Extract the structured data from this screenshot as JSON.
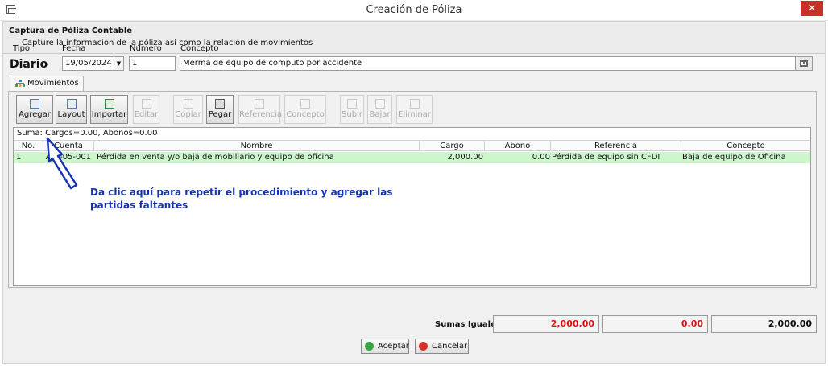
{
  "window": {
    "title": "Creación de Póliza",
    "close_glyph": "✕"
  },
  "header": {
    "title": "Captura de Póliza Contable",
    "subtitle": "Capture la información de la póliza así como la relación de movimientos"
  },
  "form": {
    "tipo_label": "Tipo",
    "tipo_value": "Diario",
    "fecha_label": "Fecha",
    "fecha_value": "19/05/2024",
    "numero_label": "Número",
    "numero_value": "1",
    "concepto_label": "Concepto",
    "concepto_value": "Merma de equipo de computo por accidente"
  },
  "tab": {
    "label": "Movimientos"
  },
  "toolbar": [
    {
      "label": "Agregar",
      "enabled": true,
      "icon": "add-icon"
    },
    {
      "label": "Layout",
      "enabled": true,
      "icon": "layout-icon"
    },
    {
      "label": "Importar",
      "enabled": true,
      "icon": "excel-import-icon"
    },
    {
      "label": "Editar",
      "enabled": false,
      "icon": "edit-icon"
    },
    {
      "label": "Copiar",
      "enabled": false,
      "icon": "copy-icon"
    },
    {
      "label": "Pegar",
      "enabled": true,
      "icon": "paste-icon"
    },
    {
      "label": "Referencia",
      "enabled": false,
      "icon": "reference-icon"
    },
    {
      "label": "Concepto",
      "enabled": false,
      "icon": "concept-icon"
    },
    {
      "label": "Subir",
      "enabled": false,
      "icon": "arrow-up-icon"
    },
    {
      "label": "Bajar",
      "enabled": false,
      "icon": "arrow-down-icon"
    },
    {
      "label": "Eliminar",
      "enabled": false,
      "icon": "delete-icon"
    }
  ],
  "grid": {
    "suma_text": "Suma: Cargos=0.00, Abonos=0.00",
    "columns": [
      "No.",
      "Cuenta",
      "Nombre",
      "Cargo",
      "Abono",
      "Referencia",
      "Concepto"
    ],
    "rows": [
      {
        "no": "1",
        "cuenta": "703-05-001",
        "nombre": "Pérdida en venta y/o baja de mobiliario y equipo de oficina",
        "cargo": "2,000.00",
        "abono": "0.00",
        "referencia": "Pérdida de equipo sin CFDI",
        "concepto": "Baja de equipo de Oficina"
      }
    ]
  },
  "callout": {
    "line1": "Da clic aquí para repetir el procedimiento y agregar las",
    "line2": "partidas faltantes",
    "color": "#1733b3"
  },
  "totals": {
    "label": "Sumas Iguales:",
    "cargo": "2,000.00",
    "abono": "0.00",
    "total": "2,000.00",
    "highlight_color": "#e01010"
  },
  "buttons": {
    "accept": "Aceptar",
    "cancel": "Cancelar"
  }
}
